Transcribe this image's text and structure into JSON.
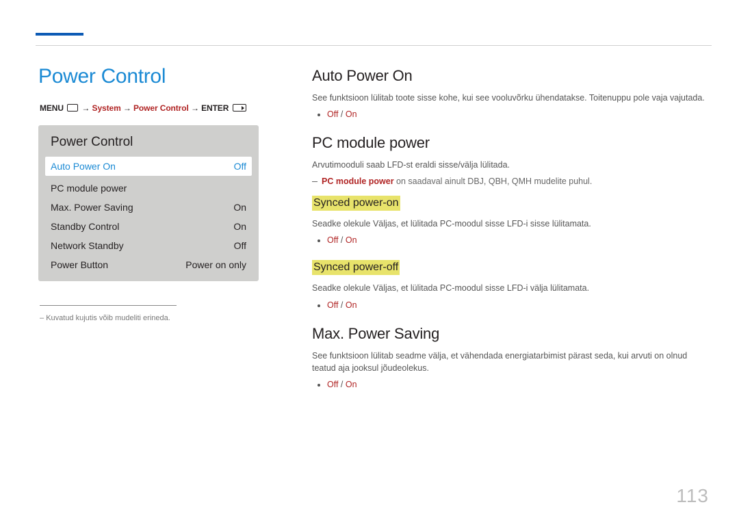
{
  "page_number": "113",
  "left": {
    "title": "Power Control",
    "crumb": {
      "menu": "MENU",
      "system": "System",
      "pcontrol": "Power Control",
      "enter": "ENTER"
    },
    "panel": {
      "title": "Power Control",
      "rows": [
        {
          "label": "Auto Power On",
          "value": "Off",
          "hl": true
        },
        {
          "label": "PC module power",
          "value": "",
          "hl": false
        },
        {
          "label": "Max. Power Saving",
          "value": "On",
          "hl": false
        },
        {
          "label": "Standby Control",
          "value": "On",
          "hl": false
        },
        {
          "label": "Network Standby",
          "value": "Off",
          "hl": false
        },
        {
          "label": "Power Button",
          "value": "Power on only",
          "hl": false
        }
      ]
    },
    "footnote_dash": "–",
    "footnote": "Kuvatud kujutis võib mudeliti erineda."
  },
  "right": {
    "s1": {
      "h": "Auto Power On",
      "p": "See funktsioon lülitab toote sisse kohe, kui see vooluvõrku ühendatakse. Toitenuppu pole vaja vajutada.",
      "opt_off": "Off",
      "opt_sep": " / ",
      "opt_on": "On"
    },
    "s2": {
      "h": "PC module power",
      "p": "Arvutimooduli saab LFD-st eraldi sisse/välja lülitada.",
      "dash_b": "PC module power",
      "dash_t": " on saadaval ainult DBJ, QBH, QMH mudelite puhul."
    },
    "s2a": {
      "h": "Synced power-on",
      "p": "Seadke olekule Väljas, et lülitada PC-moodul sisse LFD-i sisse lülitamata.",
      "opt_off": "Off",
      "opt_sep": " / ",
      "opt_on": "On"
    },
    "s2b": {
      "h": "Synced power-off",
      "p": "Seadke olekule Väljas, et lülitada PC-moodul sisse LFD-i välja lülitamata.",
      "opt_off": "Off",
      "opt_sep": " / ",
      "opt_on": "On"
    },
    "s3": {
      "h": "Max. Power Saving",
      "p": "See funktsioon lülitab seadme välja, et vähendada energiatarbimist pärast seda, kui arvuti on olnud teatud aja jooksul jõudeolekus.",
      "opt_off": "Off",
      "opt_sep": " / ",
      "opt_on": "On"
    }
  }
}
